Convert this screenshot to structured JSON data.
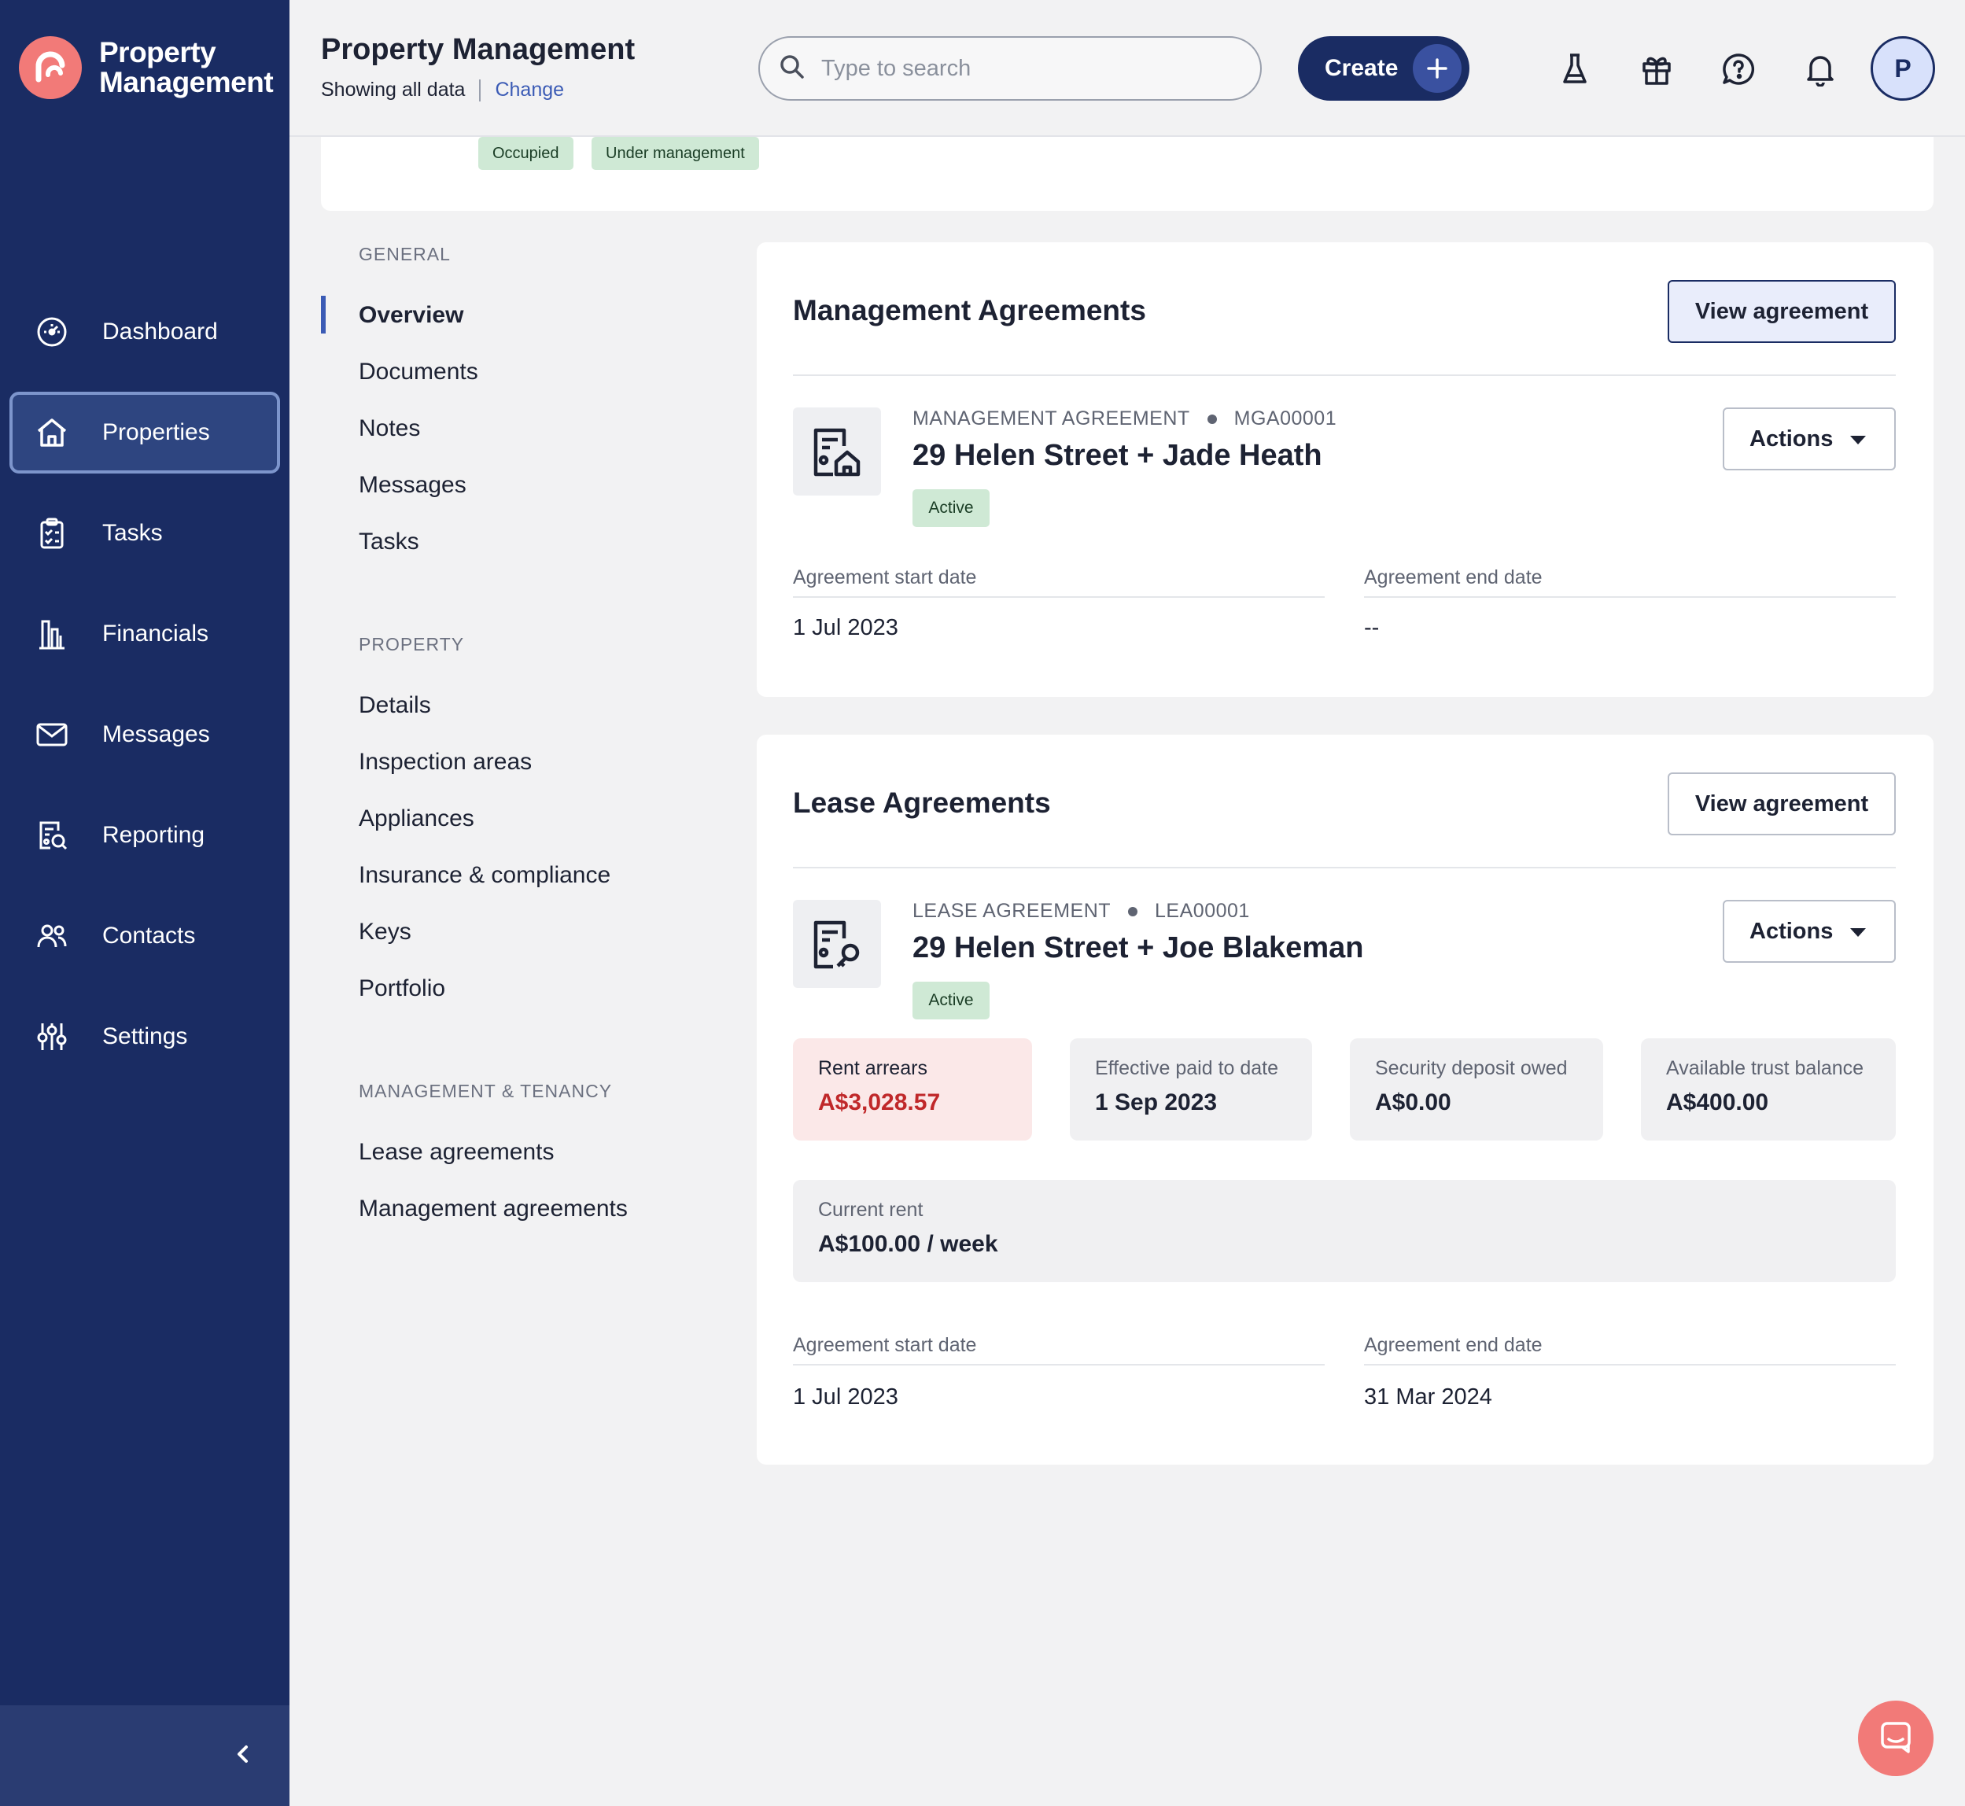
{
  "brand": {
    "name_line1": "Property",
    "name_line2": "Management"
  },
  "sidebar": {
    "items": [
      {
        "label": "Dashboard",
        "icon": "dashboard-gauge-icon"
      },
      {
        "label": "Properties",
        "icon": "house-icon",
        "active": true
      },
      {
        "label": "Tasks",
        "icon": "clipboard-check-icon"
      },
      {
        "label": "Financials",
        "icon": "building-chart-icon"
      },
      {
        "label": "Messages",
        "icon": "envelope-icon"
      },
      {
        "label": "Reporting",
        "icon": "report-search-icon"
      },
      {
        "label": "Contacts",
        "icon": "people-icon"
      },
      {
        "label": "Settings",
        "icon": "sliders-icon"
      }
    ]
  },
  "header": {
    "title": "Property Management",
    "showing": "Showing all data",
    "change": "Change",
    "search_placeholder": "Type to search",
    "create_label": "Create",
    "avatar_initial": "P"
  },
  "property": {
    "badges": [
      "Occupied",
      "Under management"
    ]
  },
  "subnav": {
    "general_heading": "GENERAL",
    "general": [
      "Overview",
      "Documents",
      "Notes",
      "Messages",
      "Tasks"
    ],
    "property_heading": "PROPERTY",
    "property": [
      "Details",
      "Inspection areas",
      "Appliances",
      "Insurance & compliance",
      "Keys",
      "Portfolio"
    ],
    "tenancy_heading": "MANAGEMENT & TENANCY",
    "tenancy": [
      "Lease agreements",
      "Management agreements"
    ]
  },
  "management": {
    "heading": "Management Agreements",
    "view_label": "View agreement",
    "type": "MANAGEMENT AGREEMENT",
    "code": "MGA00001",
    "title": "29 Helen Street + Jade Heath",
    "status": "Active",
    "actions_label": "Actions",
    "start_label": "Agreement start date",
    "start_value": "1 Jul 2023",
    "end_label": "Agreement end date",
    "end_value": "--"
  },
  "lease": {
    "heading": "Lease Agreements",
    "view_label": "View agreement",
    "type": "LEASE AGREEMENT",
    "code": "LEA00001",
    "title": "29 Helen Street + Joe Blakeman",
    "status": "Active",
    "actions_label": "Actions",
    "stats": [
      {
        "label": "Rent arrears",
        "value": "A$3,028.57",
        "alert": true
      },
      {
        "label": "Effective paid to date",
        "value": "1 Sep 2023"
      },
      {
        "label": "Security deposit owed",
        "value": "A$0.00"
      },
      {
        "label": "Available trust balance",
        "value": "A$400.00"
      }
    ],
    "rent_label": "Current rent",
    "rent_value": "A$100.00 / week",
    "start_label": "Agreement start date",
    "start_value": "1 Jul 2023",
    "end_label": "Agreement end date",
    "end_value": "31 Mar 2024"
  },
  "colors": {
    "sidebar": "#1a2c63",
    "accent": "#3b5bb5",
    "brand_coral": "#f27a78",
    "success_bg": "#cfe9d5",
    "alert_text": "#c0282a"
  }
}
